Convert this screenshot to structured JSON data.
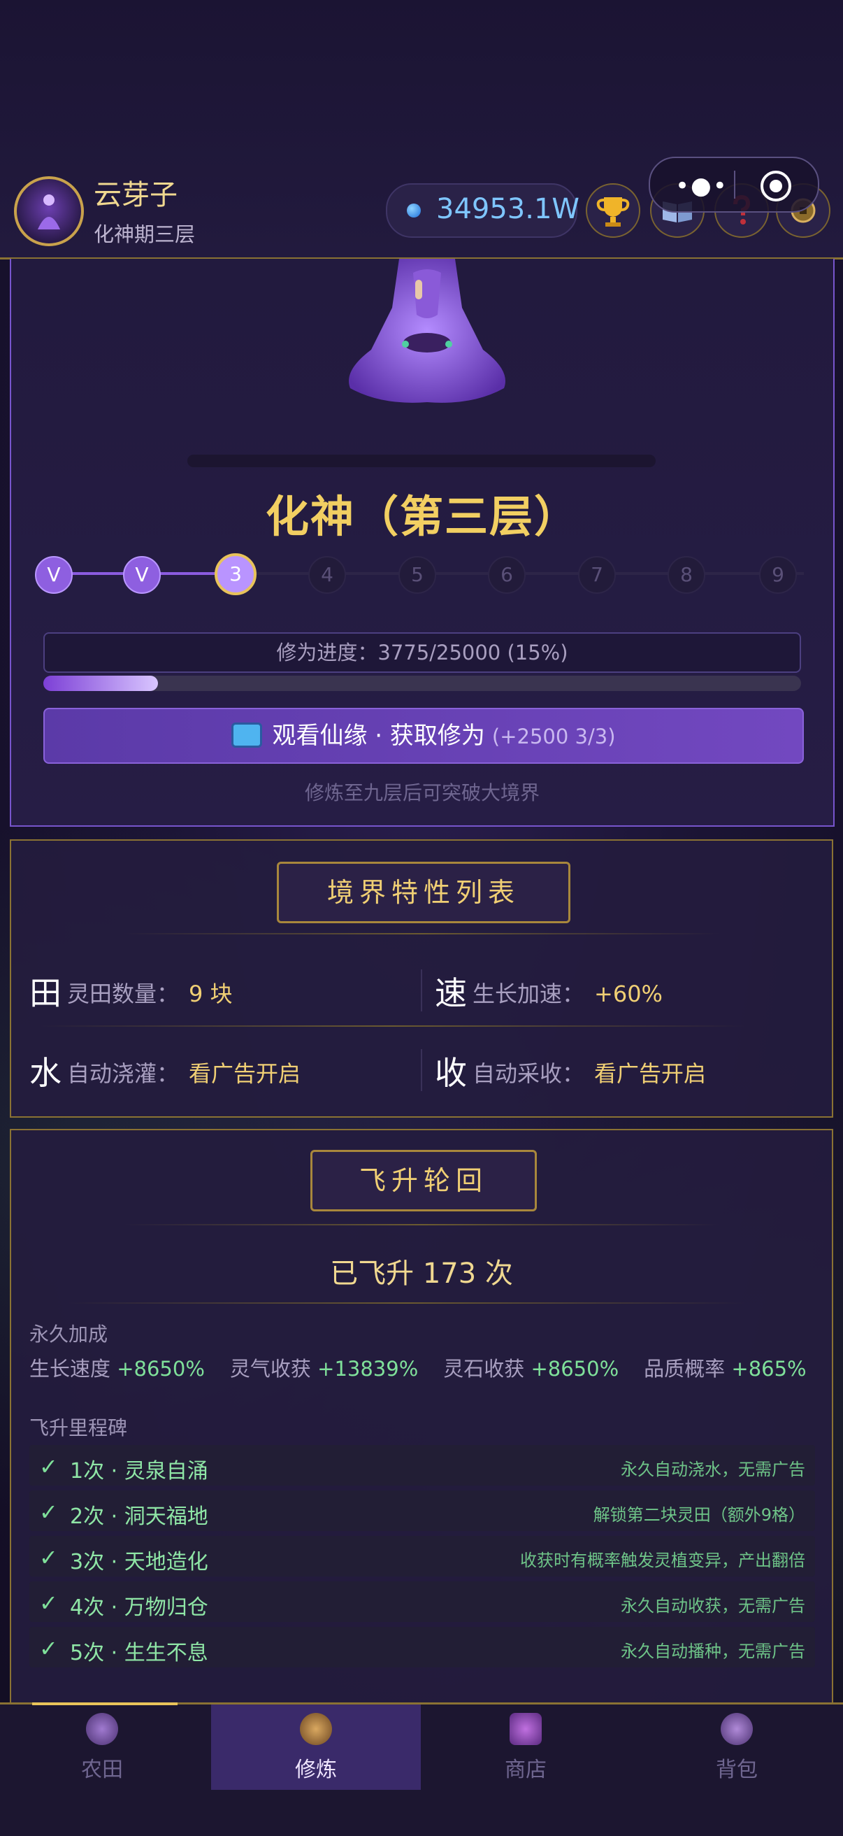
{
  "header": {
    "player_name": "云芽子",
    "player_realm": "化神期三层",
    "spirit_stones": "34953.1W",
    "icons": [
      "trophy-icon",
      "book-icon",
      "question-icon",
      "coin-icon"
    ],
    "capsule_dots": "•●•"
  },
  "cultivation": {
    "realm_title": "化神（第三层）",
    "steps": [
      "V",
      "V",
      "3",
      "4",
      "5",
      "6",
      "7",
      "8",
      "9"
    ],
    "current_step": 3,
    "progress_label": "修为进度：3775/25000 (15%)",
    "progress_fraction": 0.151,
    "watch_button": "观看仙缘 · 获取修为",
    "watch_extra": "(+2500  3/3)",
    "hint": "修炼至九层后可突破大境界"
  },
  "traits": {
    "title": "境界特性列表",
    "items": [
      {
        "glyph": "田",
        "label": "灵田数量：",
        "value": "9 块"
      },
      {
        "glyph": "速",
        "label": "生长加速：",
        "value": "+60%"
      },
      {
        "glyph": "水",
        "label": "自动浇灌：",
        "value": "看广告开启"
      },
      {
        "glyph": "收",
        "label": "自动采收：",
        "value": "看广告开启"
      }
    ]
  },
  "ascension": {
    "title": "飞升轮回",
    "count_text": "已飞升 173 次",
    "bonus_title": "永久加成",
    "bonuses": [
      {
        "label": "生长速度",
        "value": "+8650%"
      },
      {
        "label": "灵气收获",
        "value": "+13839%"
      },
      {
        "label": "灵石收获",
        "value": "+8650%"
      },
      {
        "label": "品质概率",
        "value": "+865%"
      }
    ],
    "milestone_title": "飞升里程碑",
    "milestones": [
      {
        "title": "1次 · 灵泉自涌",
        "desc": "永久自动浇水，无需广告"
      },
      {
        "title": "2次 · 洞天福地",
        "desc": "解锁第二块灵田（额外9格）"
      },
      {
        "title": "3次 · 天地造化",
        "desc": "收获时有概率触发灵植变异，产出翻倍"
      },
      {
        "title": "4次 · 万物归仓",
        "desc": "永久自动收获，无需广告"
      },
      {
        "title": "5次 · 生生不息",
        "desc": "永久自动播种，无需广告"
      }
    ]
  },
  "nav": {
    "tabs": [
      {
        "label": "农田",
        "icon": "farm-icon"
      },
      {
        "label": "修炼",
        "icon": "cultivate-icon"
      },
      {
        "label": "商店",
        "icon": "shop-icon"
      },
      {
        "label": "背包",
        "icon": "bag-icon"
      }
    ],
    "active": "修炼"
  }
}
